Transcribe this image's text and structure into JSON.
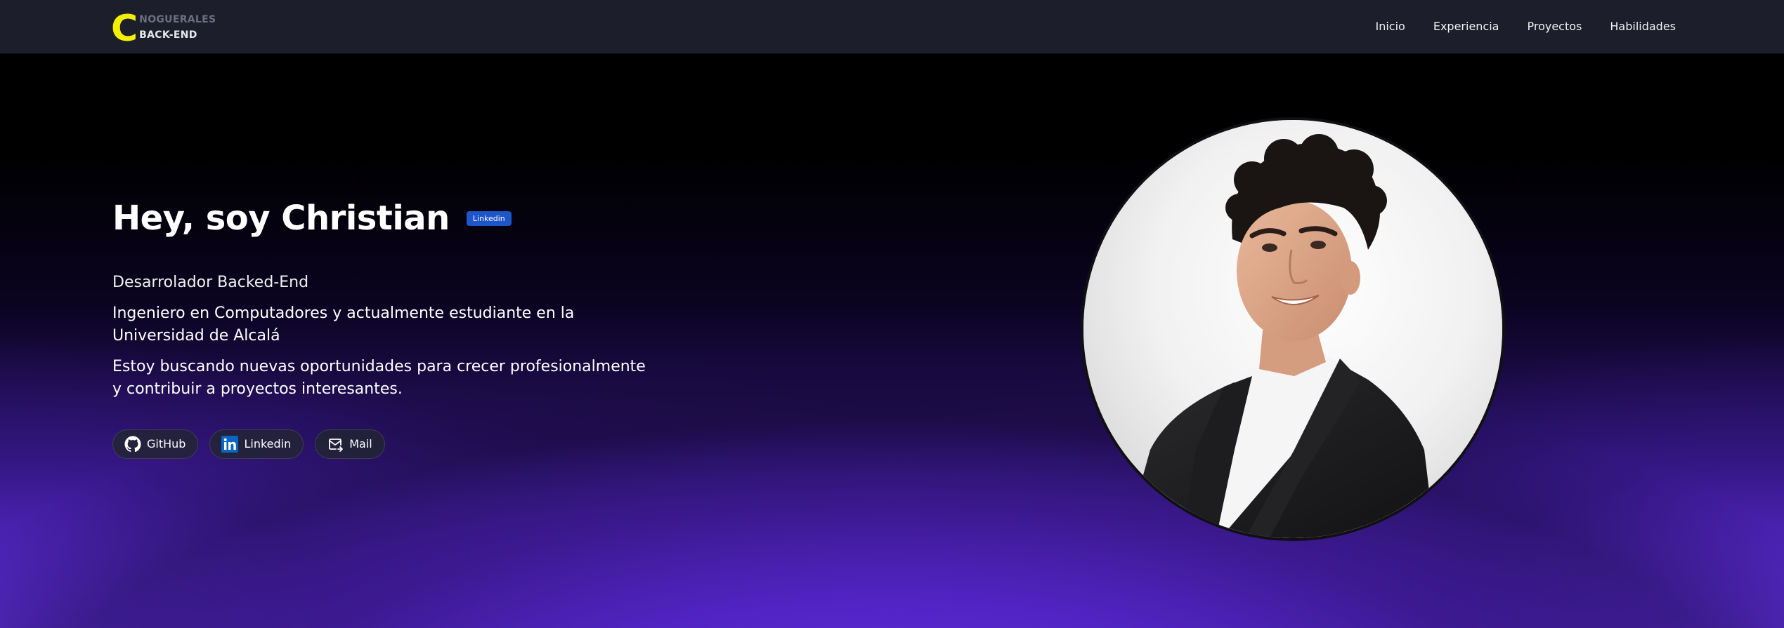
{
  "brand": {
    "letter": "C",
    "top_text": "NOGUERALES",
    "bottom_text": "BACK-END"
  },
  "nav": {
    "items": [
      "Inicio",
      "Experiencia",
      "Proyectos",
      "Habilidades"
    ]
  },
  "hero": {
    "title": "Hey, soy Christian",
    "badge": "Linkedin",
    "role": "Desarrolador Backed-End",
    "paragraph1": "Ingeniero en Computadores y actualmente estudiante en la Universidad de Alcalá",
    "paragraph2": "Estoy buscando nuevas oportunidades para crecer profesionalmente y contribuir a proyectos interesantes."
  },
  "socials": [
    {
      "label": "GitHub",
      "icon": "github-icon"
    },
    {
      "label": "Linkedin",
      "icon": "linkedin-icon"
    },
    {
      "label": "Mail",
      "icon": "mail-icon"
    }
  ],
  "colors": {
    "navbar_bg": "#1c1f2b",
    "brand_accent": "#f4f000",
    "badge_bg": "#1e55c8",
    "linkedin_blue": "#0a66c2",
    "gradient_purple": "#5a2bd6"
  }
}
